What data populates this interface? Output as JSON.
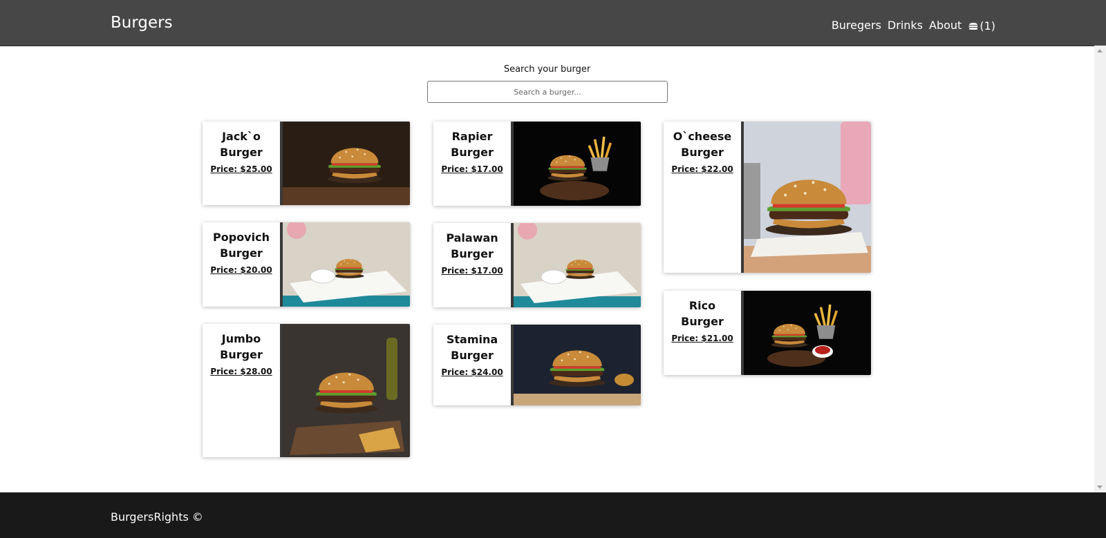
{
  "header": {
    "brand": "Burgers",
    "nav": [
      "Buregers",
      "Drinks",
      "About"
    ],
    "cart_count": "(1)"
  },
  "search": {
    "label": "Search your burger",
    "placeholder": "Search a burger..."
  },
  "cards": [
    {
      "name": "Jack`o Burger",
      "price": "Price: $25.00"
    },
    {
      "name": "Rapier Burger",
      "price": "Price: $17.00"
    },
    {
      "name": "O`cheese Burger",
      "price": "Price: $22.00"
    },
    {
      "name": "Popovich Burger",
      "price": "Price: $20.00"
    },
    {
      "name": "Palawan Burger",
      "price": "Price: $17.00"
    },
    {
      "name": "Rico Burger",
      "price": "Price: $21.00"
    },
    {
      "name": "Jumbo Burger",
      "price": "Price: $28.00"
    },
    {
      "name": "Stamina Burger",
      "price": "Price: $24.00"
    }
  ],
  "footer": {
    "text": "BurgersRights ©"
  },
  "colors": {
    "header_bg": "#474747",
    "footer_bg": "#191919",
    "bun": "#c98a3a",
    "lettuce": "#5f9e2f",
    "patty": "#4a2a18"
  }
}
